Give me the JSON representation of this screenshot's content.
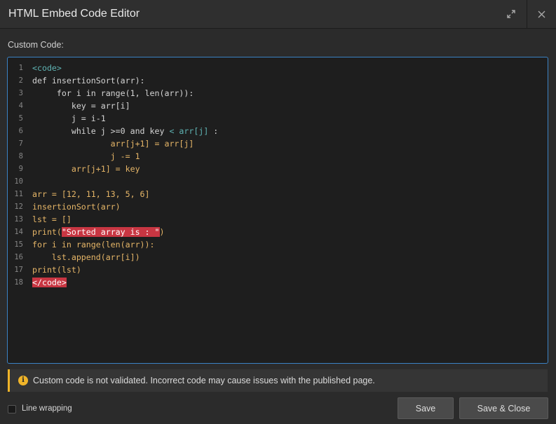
{
  "window": {
    "title": "HTML Embed Code Editor",
    "expand_icon": "expand-arrows-icon",
    "close_icon": "close-icon"
  },
  "editor": {
    "label": "Custom Code:",
    "lines": [
      {
        "n": "1",
        "segments": [
          {
            "t": "<code>",
            "c": "tag"
          }
        ]
      },
      {
        "n": "2",
        "segments": [
          {
            "t": "def insertionSort(arr):",
            "c": "plain"
          }
        ]
      },
      {
        "n": "3",
        "segments": [
          {
            "t": "     for i in range(1, len(arr)):",
            "c": "plain"
          }
        ]
      },
      {
        "n": "4",
        "segments": [
          {
            "t": "        key = arr[i]",
            "c": "plain"
          }
        ]
      },
      {
        "n": "5",
        "segments": [
          {
            "t": "        j = i-1",
            "c": "plain"
          }
        ]
      },
      {
        "n": "6",
        "segments": [
          {
            "t": "        while j >=0 and key ",
            "c": "plain"
          },
          {
            "t": "< arr[j]",
            "c": "tag"
          },
          {
            "t": " :",
            "c": "plain"
          }
        ]
      },
      {
        "n": "7",
        "segments": [
          {
            "t": "                arr[j+1] = arr[j]",
            "c": "default"
          }
        ]
      },
      {
        "n": "8",
        "segments": [
          {
            "t": "                j -= 1",
            "c": "default"
          }
        ]
      },
      {
        "n": "9",
        "segments": [
          {
            "t": "        arr[j+1] = key",
            "c": "default"
          }
        ]
      },
      {
        "n": "10",
        "segments": []
      },
      {
        "n": "11",
        "segments": [
          {
            "t": "arr = [12, 11, 13, 5, 6]",
            "c": "default"
          }
        ]
      },
      {
        "n": "12",
        "segments": [
          {
            "t": "insertionSort(arr)",
            "c": "default"
          }
        ]
      },
      {
        "n": "13",
        "segments": [
          {
            "t": "lst = []",
            "c": "default"
          }
        ]
      },
      {
        "n": "14",
        "segments": [
          {
            "t": "print(",
            "c": "default"
          },
          {
            "t": "\"Sorted array is : \"",
            "c": "str"
          },
          {
            "t": ")",
            "c": "default"
          }
        ]
      },
      {
        "n": "15",
        "segments": [
          {
            "t": "for i in range(len(arr)):",
            "c": "default"
          }
        ]
      },
      {
        "n": "16",
        "segments": [
          {
            "t": "    lst.append(arr[i])",
            "c": "default"
          }
        ]
      },
      {
        "n": "17",
        "segments": [
          {
            "t": "print(lst)",
            "c": "default"
          }
        ]
      },
      {
        "n": "18",
        "segments": [
          {
            "t": "</code>",
            "c": "errtag"
          }
        ]
      }
    ]
  },
  "warning": {
    "icon": "info-icon",
    "icon_glyph": "i",
    "text": "Custom code is not validated. Incorrect code may cause issues with the published page."
  },
  "footer": {
    "line_wrapping_label": "Line wrapping",
    "line_wrapping_checked": false,
    "save_label": "Save",
    "save_close_label": "Save & Close"
  },
  "colors": {
    "accent_border": "#3b82c4",
    "warning": "#f0b429",
    "error_highlight": "#c83642",
    "code_default": "#e5b567",
    "code_tag": "#5fb3b3"
  }
}
